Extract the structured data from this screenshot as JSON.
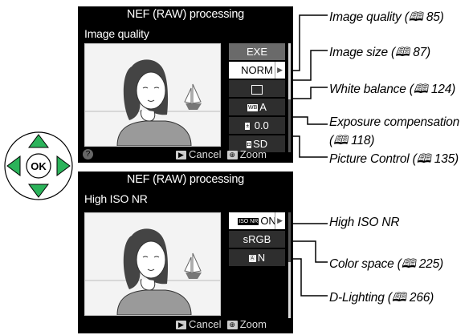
{
  "screen1": {
    "title": "NEF (RAW) processing",
    "subtitle": "Image quality",
    "items": [
      {
        "label": "EXE"
      },
      {
        "label": "NORM"
      },
      {
        "label": "▣"
      },
      {
        "label": "A",
        "badge": "WB"
      },
      {
        "label": "0.0",
        "badge": "±"
      },
      {
        "label": "SD",
        "badge": "◘"
      }
    ],
    "footer": {
      "cancel": "Cancel",
      "zoom": "Zoom",
      "help": "?"
    }
  },
  "screen2": {
    "title": "NEF (RAW) processing",
    "subtitle": "High ISO NR",
    "items": [
      {
        "label": "ON",
        "badge": "ISO NR"
      },
      {
        "label": "sRGB"
      },
      {
        "label": "N",
        "badge": "Ⓐ"
      }
    ],
    "footer": {
      "cancel": "Cancel",
      "zoom": "Zoom"
    }
  },
  "callouts": {
    "image_quality": "Image quality (🕮 85)",
    "image_size": "Image size (🕮 87)",
    "white_balance": "White balance (🕮 124)",
    "exposure_1": "Exposure compensation",
    "exposure_2": "(🕮 118)",
    "picture_control": "Picture Control (🕮 135)",
    "high_iso": "High ISO NR",
    "color_space": "Color space (🕮 225)",
    "d_lighting": "D-Lighting (🕮 266)"
  },
  "multiselector": {
    "center": "OK"
  },
  "colors": {
    "accent_green": "#2bb35a",
    "screen_bg": "#000000"
  }
}
